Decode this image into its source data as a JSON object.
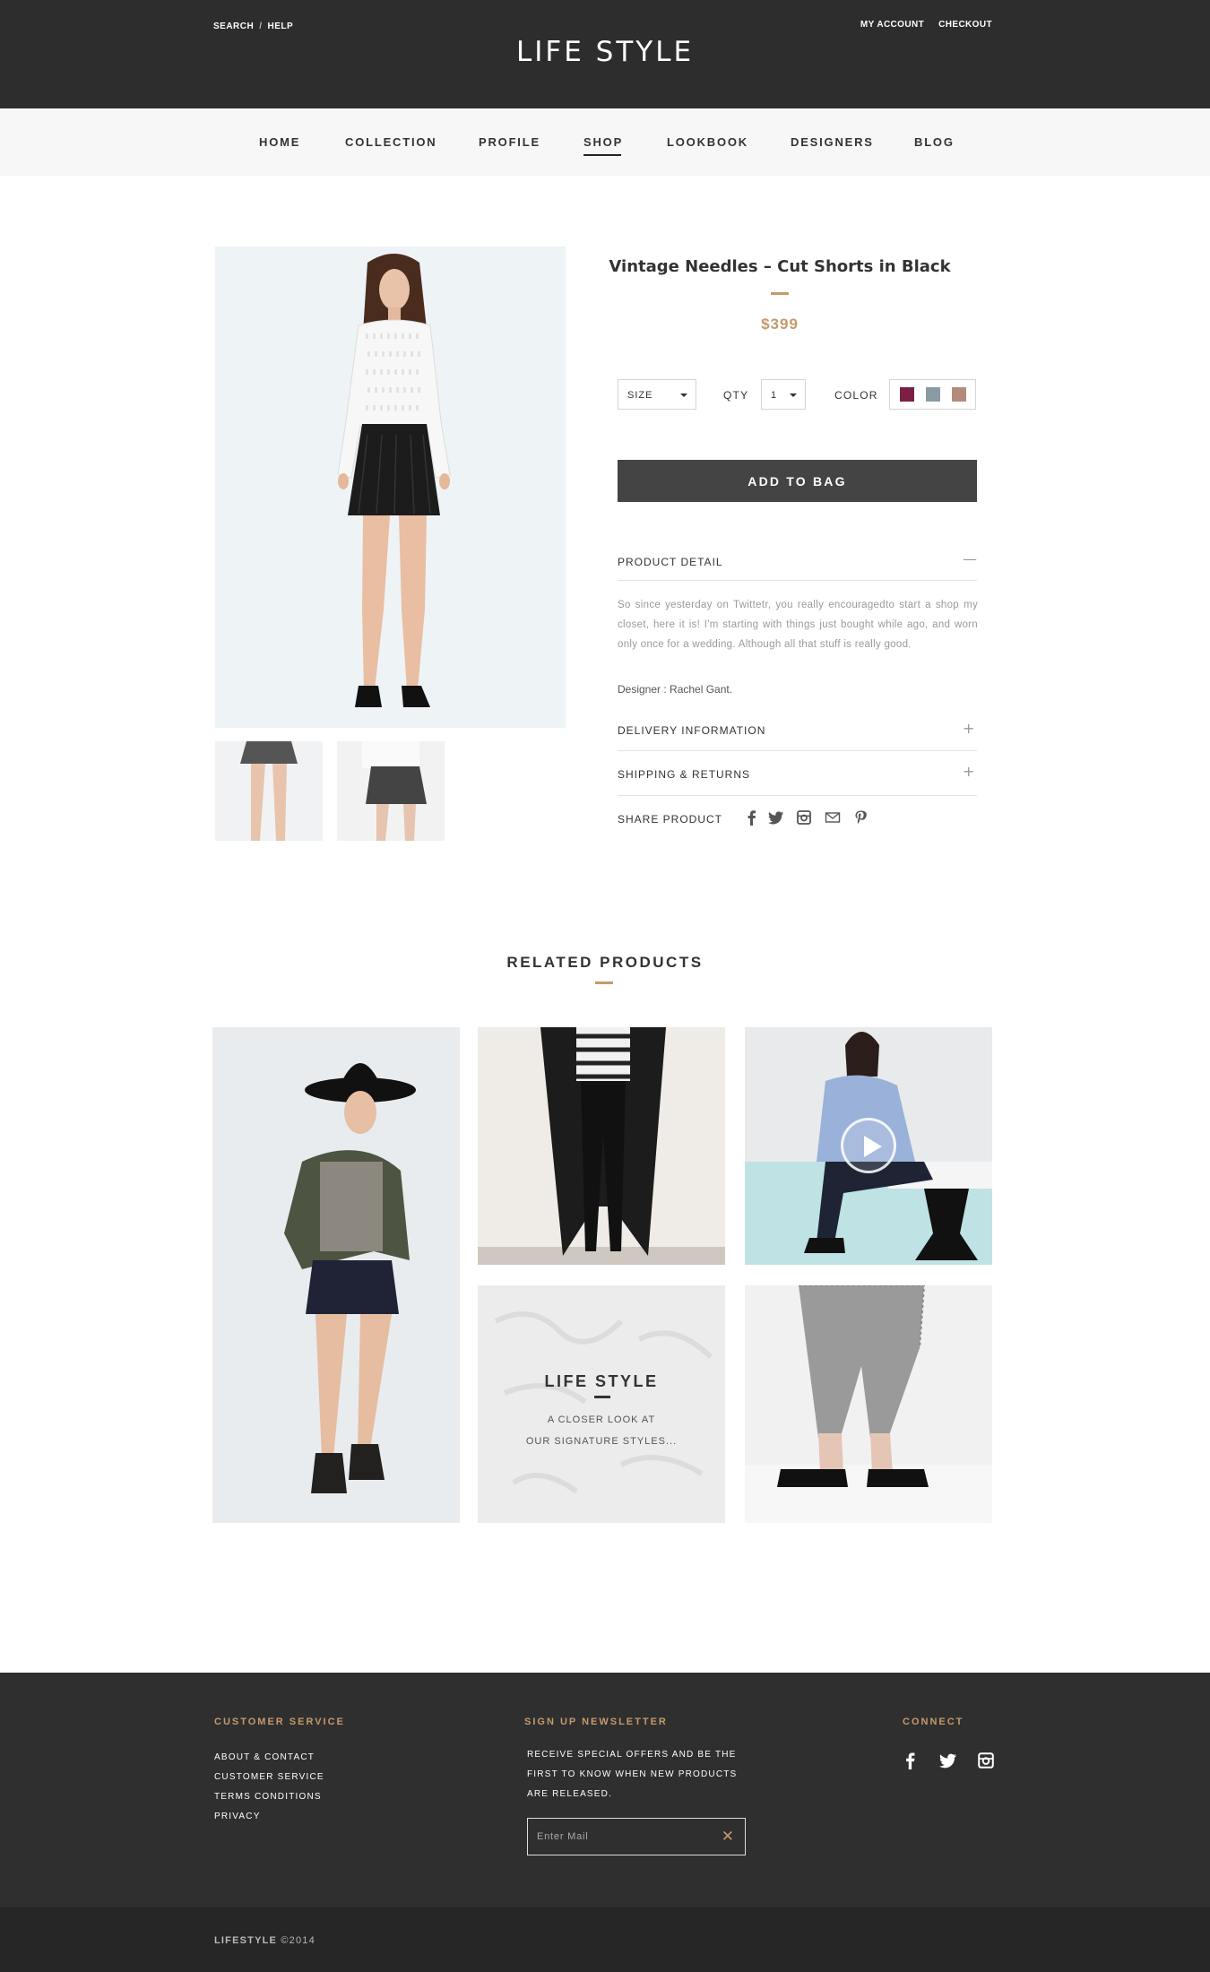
{
  "header": {
    "search_label": "SEARCH",
    "help_label": "HELP",
    "separator": "/",
    "my_account_label": "MY ACCOUNT",
    "checkout_label": "CHECKOUT",
    "logo_text": "LIFE STYLE"
  },
  "nav": {
    "items": [
      {
        "label": "HOME"
      },
      {
        "label": "COLLECTION"
      },
      {
        "label": "PROFILE"
      },
      {
        "label": "SHOP",
        "active": true
      },
      {
        "label": "LOOKBOOK"
      },
      {
        "label": "DESIGNERS"
      },
      {
        "label": "BLOG"
      }
    ]
  },
  "product": {
    "title": "Vintage Needles – Cut Shorts in Black",
    "price": "$399",
    "size_label": "SIZE",
    "qty_label": "QTY",
    "qty_value": "1",
    "color_label": "COLOR",
    "colors": [
      "#7c1f45",
      "#8a9aa3",
      "#b58a7e"
    ],
    "add_to_bag_label": "ADD TO BAG",
    "detail_heading": "PRODUCT DETAIL",
    "detail_icon": "—",
    "detail_text": "So since yesterday on Twittetr, you really encouragedto start a shop my closet, here it is! I'm starting with things just bought while ago, and worn only once for a wedding. Although all that stuff is really good.",
    "designer_text": "Designer : Rachel Gant.",
    "delivery_heading": "DELIVERY INFORMATION",
    "shipping_heading": "SHIPPING & RETURNS",
    "plus_icon": "+",
    "share_label": "SHARE PRODUCT",
    "share_icons": [
      "facebook-icon",
      "twitter-icon",
      "instagram-icon",
      "mail-icon",
      "pinterest-icon"
    ]
  },
  "related": {
    "heading": "RELATED PRODUCTS",
    "promo_title": "LIFE STYLE",
    "promo_line1": "A CLOSER LOOK AT",
    "promo_line2": "OUR SIGNATURE STYLES..."
  },
  "footer": {
    "customer_service_heading": "CUSTOMER SERVICE",
    "links": [
      "ABOUT & CONTACT",
      "CUSTOMER SERVICE",
      "TERMS CONDITIONS",
      "PRIVACY"
    ],
    "newsletter_heading": "SIGN UP NEWSLETTER",
    "newsletter_text": "RECEIVE SPECIAL OFFERS AND BE THE FIRST TO KNOW WHEN NEW PRODUCTS ARE RELEASED.",
    "email_placeholder": "Enter Mail",
    "clear_icon": "✕",
    "connect_heading": "CONNECT",
    "social_icons": [
      "facebook-icon",
      "twitter-icon",
      "instagram-icon"
    ],
    "brand": "LIFESTYLE",
    "year": "©2014"
  },
  "colors": {
    "dark": "#2d2d2d",
    "accent_gold": "#c49a6c",
    "button": "#444444"
  }
}
